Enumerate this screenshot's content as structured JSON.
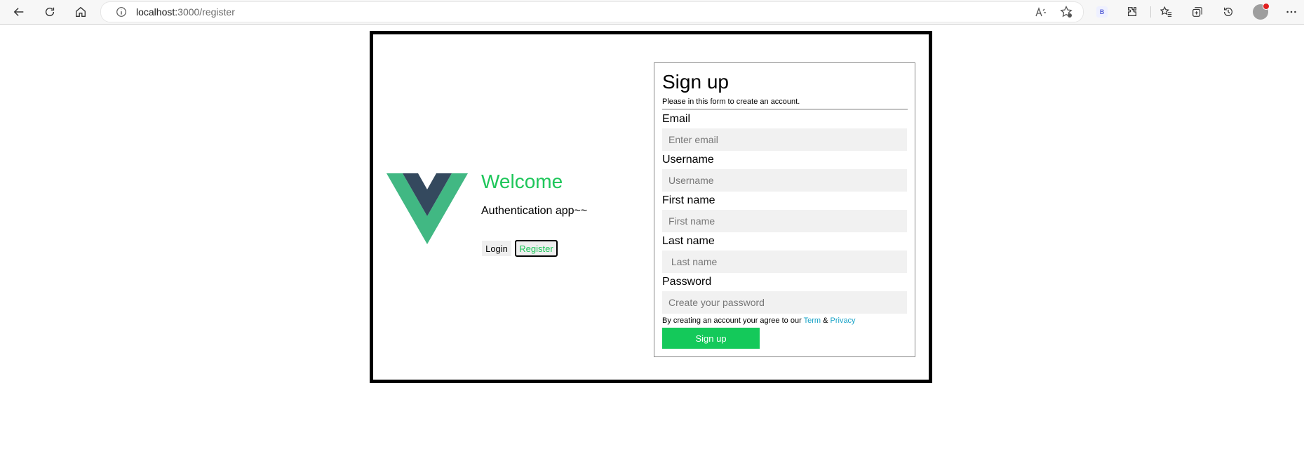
{
  "browser": {
    "url_host": "localhost:",
    "url_path": "3000/register"
  },
  "hero": {
    "welcome": "Welcome",
    "subtitle": "Authentication app~~",
    "login_label": "Login",
    "register_label": "Register"
  },
  "form": {
    "title": "Sign up",
    "description": "Please in this form to create an account.",
    "fields": [
      {
        "label": "Email",
        "placeholder": "Enter email"
      },
      {
        "label": "Username",
        "placeholder": "Username"
      },
      {
        "label": "First name",
        "placeholder": "First name"
      },
      {
        "label": "Last name",
        "placeholder": " Last name"
      },
      {
        "label": "Password",
        "placeholder": "Create your password"
      }
    ],
    "terms_text": "By creating an account your agree to our ",
    "terms_link": "Term",
    "terms_amp": " & ",
    "privacy_link": "Privacy",
    "submit_label": "Sign up"
  },
  "colors": {
    "accent_green": "#1ec65a",
    "button_green": "#14c95a",
    "link_blue": "#1aa3c7",
    "vue_green": "#41b883",
    "vue_dark": "#34495e"
  },
  "icons": [
    "back-icon",
    "refresh-icon",
    "home-icon",
    "info-icon",
    "read-aloud-icon",
    "add-favorite-icon",
    "extensions-icon",
    "favorites-icon",
    "collections-icon",
    "history-icon",
    "profile-avatar",
    "more-icon"
  ]
}
